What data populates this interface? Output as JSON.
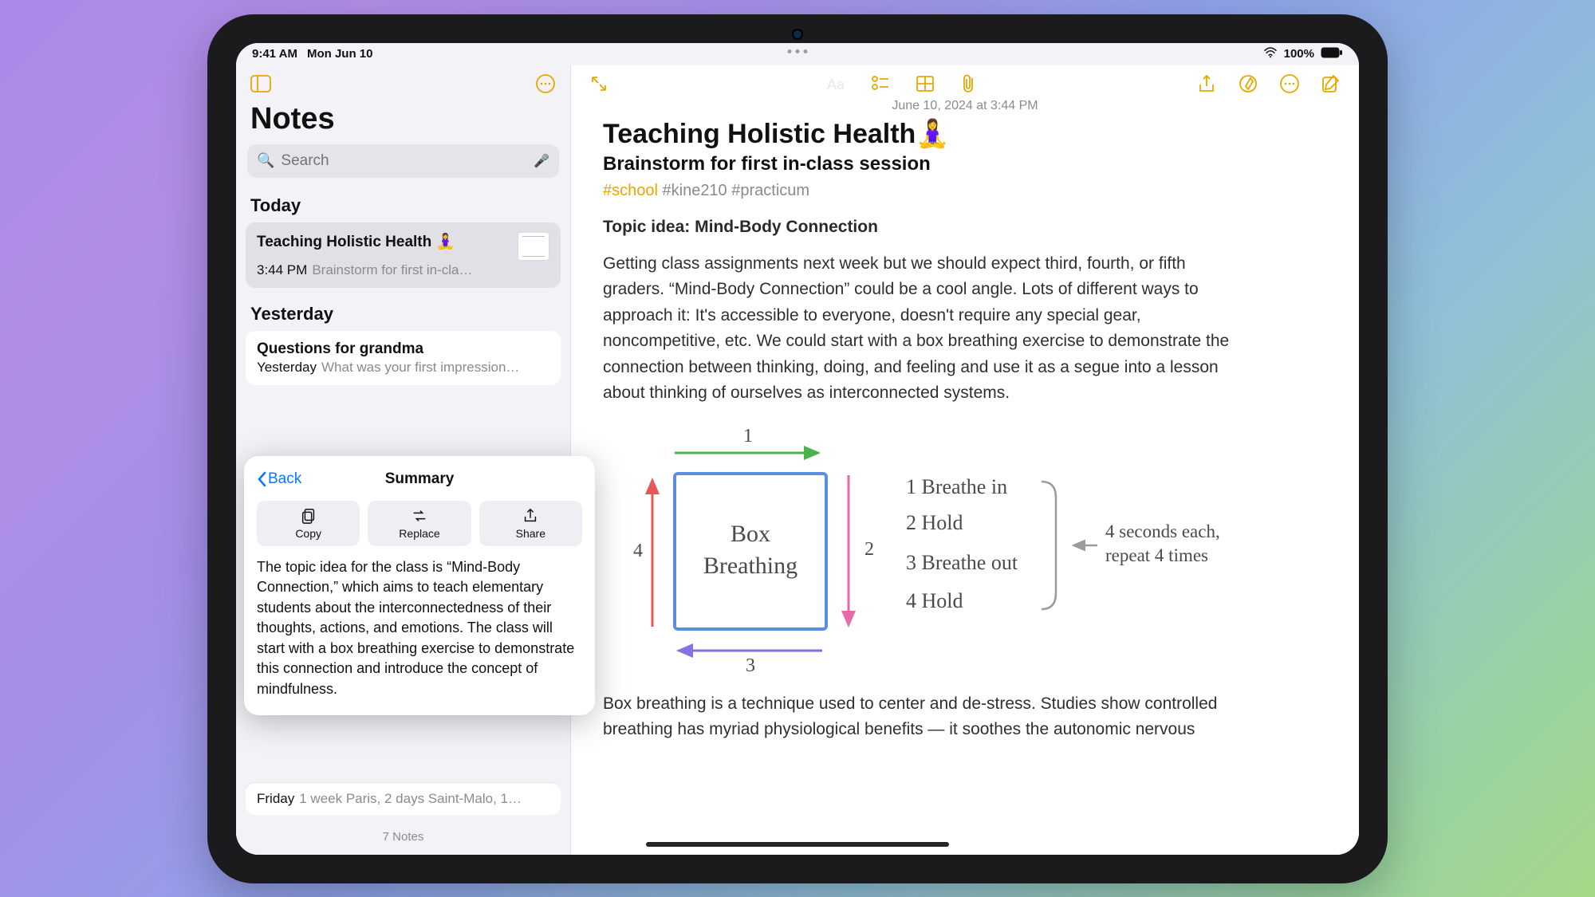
{
  "status": {
    "time": "9:41 AM",
    "date": "Mon Jun 10",
    "battery": "100%"
  },
  "sidebar": {
    "title": "Notes",
    "search_placeholder": "Search",
    "sections": {
      "today": "Today",
      "yesterday": "Yesterday"
    },
    "notes": {
      "today": [
        {
          "title": "Teaching Holistic Health 🧘‍♀️",
          "time": "3:44 PM",
          "preview": "Brainstorm for first in-cla…"
        }
      ],
      "yesterday": [
        {
          "title": "Questions for grandma",
          "time": "Yesterday",
          "preview": "What was your first impression…"
        }
      ]
    },
    "peek": {
      "day": "Friday",
      "preview": "1 week Paris, 2 days Saint-Malo, 1…"
    },
    "footer": "7 Notes"
  },
  "popover": {
    "back": "Back",
    "title": "Summary",
    "buttons": {
      "copy": "Copy",
      "replace": "Replace",
      "share": "Share"
    },
    "text": "The topic idea for the class is “Mind-Body Connection,” which aims to teach elementary students about the interconnectedness of their thoughts, actions, and emotions. The class will start with a box breathing exercise to demonstrate this connection and introduce the concept of mindfulness."
  },
  "note": {
    "date": "June 10, 2024 at 3:44 PM",
    "title": "Teaching Holistic Health🧘‍♀️",
    "subtitle": "Brainstorm for first in-class session",
    "tags": {
      "t1": "#school",
      "t2": "#kine210",
      "t3": "#practicum"
    },
    "topic": "Topic idea: Mind-Body Connection",
    "para1": "Getting class assignments next week but we should expect third, fourth, or fifth graders. “Mind-Body Connection” could be a cool angle. Lots of different ways to approach it: It's accessible to everyone, doesn't require any special gear, noncompetitive, etc. We could start with a box breathing exercise to demonstrate the connection between thinking, doing, and feeling and use it as a segue into a lesson about thinking of ourselves as interconnected systems.",
    "sketch": {
      "box_label": "Box Breathing",
      "sides": {
        "s1": "1",
        "s2": "2",
        "s3": "3",
        "s4": "4"
      },
      "steps": {
        "l1": "1  Breathe in",
        "l2": "2  Hold",
        "l3": "3  Breathe out",
        "l4": "4  Hold"
      },
      "hint1": "4 seconds each,",
      "hint2": "repeat 4 times"
    },
    "para2": "Box breathing is a technique used to center and de-stress. Studies show controlled breathing has myriad physiological benefits — it soothes the autonomic nervous"
  }
}
